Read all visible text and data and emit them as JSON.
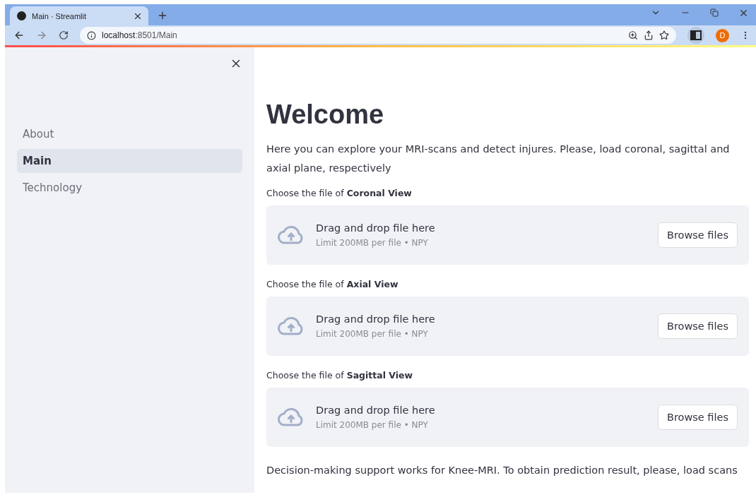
{
  "browser": {
    "tab_title": "Main · Streamlit",
    "url_host": "localhost",
    "url_rest": ":8501/Main",
    "profile_initial": "D"
  },
  "sidebar": {
    "items": [
      {
        "label": "About",
        "selected": false
      },
      {
        "label": "Main",
        "selected": true
      },
      {
        "label": "Technology",
        "selected": false
      }
    ]
  },
  "main": {
    "title": "Welcome",
    "intro": "Here you can explore your MRI-scans and detect injures. Please, load coronal, sagittal and axial plane, respectively",
    "uploaders": [
      {
        "label": "Choose the file of **Coronal View**",
        "drop_text": "Drag and drop file here",
        "limit": "Limit 200MB per file • NPY",
        "button": "Browse files"
      },
      {
        "label": "Choose the file of **Axial View**",
        "drop_text": "Drag and drop file here",
        "limit": "Limit 200MB per file • NPY",
        "button": "Browse files"
      },
      {
        "label": "Choose the file of **Sagittal View**",
        "drop_text": "Drag and drop file here",
        "limit": "Limit 200MB per file • NPY",
        "button": "Browse files"
      }
    ],
    "footer_text": "Decision-making support works for Knee-MRI. To obtain prediction result, please, load scans"
  }
}
